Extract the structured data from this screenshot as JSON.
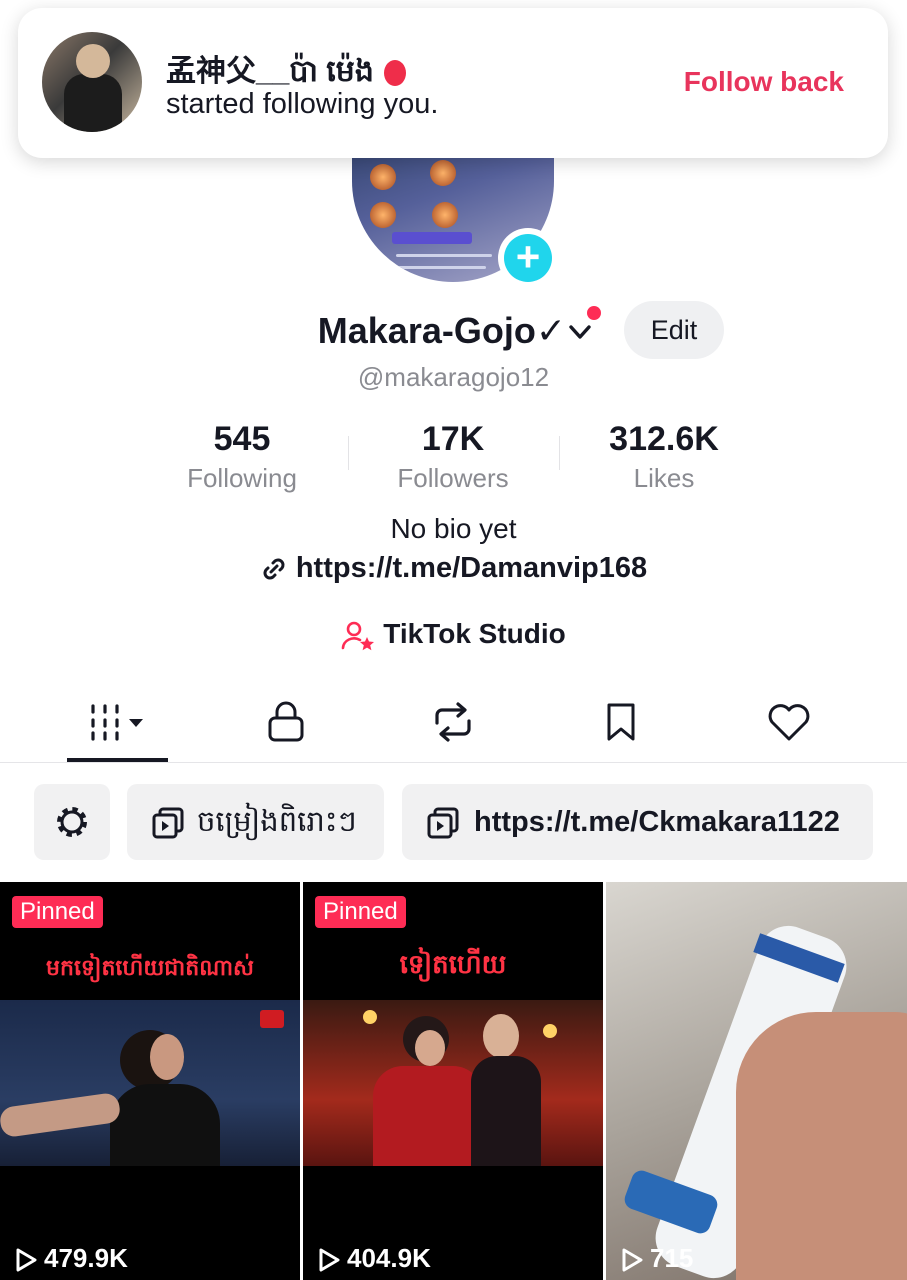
{
  "notification": {
    "name": "孟神父__ប៉ា ម៉េង",
    "message": "started following you.",
    "action": "Follow back"
  },
  "profile": {
    "display_name": "Makara-Gojo✓",
    "edit_label": "Edit",
    "handle": "@makaragojo12",
    "stats": [
      {
        "value": "545",
        "label": "Following"
      },
      {
        "value": "17K",
        "label": "Followers"
      },
      {
        "value": "312.6K",
        "label": "Likes"
      }
    ],
    "bio": "No bio yet",
    "link": "https://t.me/Damanvip168",
    "studio": "TikTok Studio"
  },
  "tabs": [
    "videos-grid",
    "private",
    "reposts",
    "favorites",
    "liked"
  ],
  "chips": {
    "playlist_1": "ចម្រៀងពិរោះៗ",
    "playlist_2": "https://t.me/Ckmakara1122"
  },
  "videos": [
    {
      "pinned_label": "Pinned",
      "caption": "មកទៀតហើយជាតិណាស់",
      "views": "479.9K"
    },
    {
      "pinned_label": "Pinned",
      "caption": "ទៀតហើយ",
      "views": "404.9K"
    },
    {
      "views": "715"
    }
  ],
  "colors": {
    "accent": "#fe2c55",
    "follow_back": "#e8345c",
    "add_button": "#20d5ec"
  }
}
